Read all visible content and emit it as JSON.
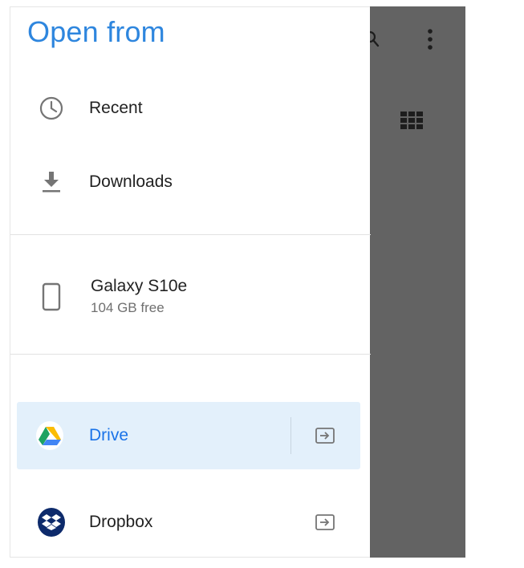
{
  "drawer": {
    "title": "Open from",
    "items": [
      {
        "label": "Recent",
        "icon": "clock-icon"
      },
      {
        "label": "Downloads",
        "icon": "download-icon"
      }
    ],
    "device": {
      "label": "Galaxy S10e",
      "sub": "104 GB free",
      "icon": "phone-icon"
    },
    "cloud": [
      {
        "label": "Drive",
        "icon": "google-drive-icon",
        "action_icon": "eject-icon",
        "selected": true
      },
      {
        "label": "Dropbox",
        "icon": "dropbox-icon",
        "action_icon": "eject-icon",
        "selected": false
      }
    ]
  },
  "background_toolbar": {
    "icons": [
      "search-icon",
      "more-vert-icon",
      "grid-view-icon"
    ]
  },
  "colors": {
    "accent": "#2e86de",
    "selected_bg": "#e3f0fb",
    "scrim": "#636363",
    "dropbox": "#0d2a6b"
  }
}
